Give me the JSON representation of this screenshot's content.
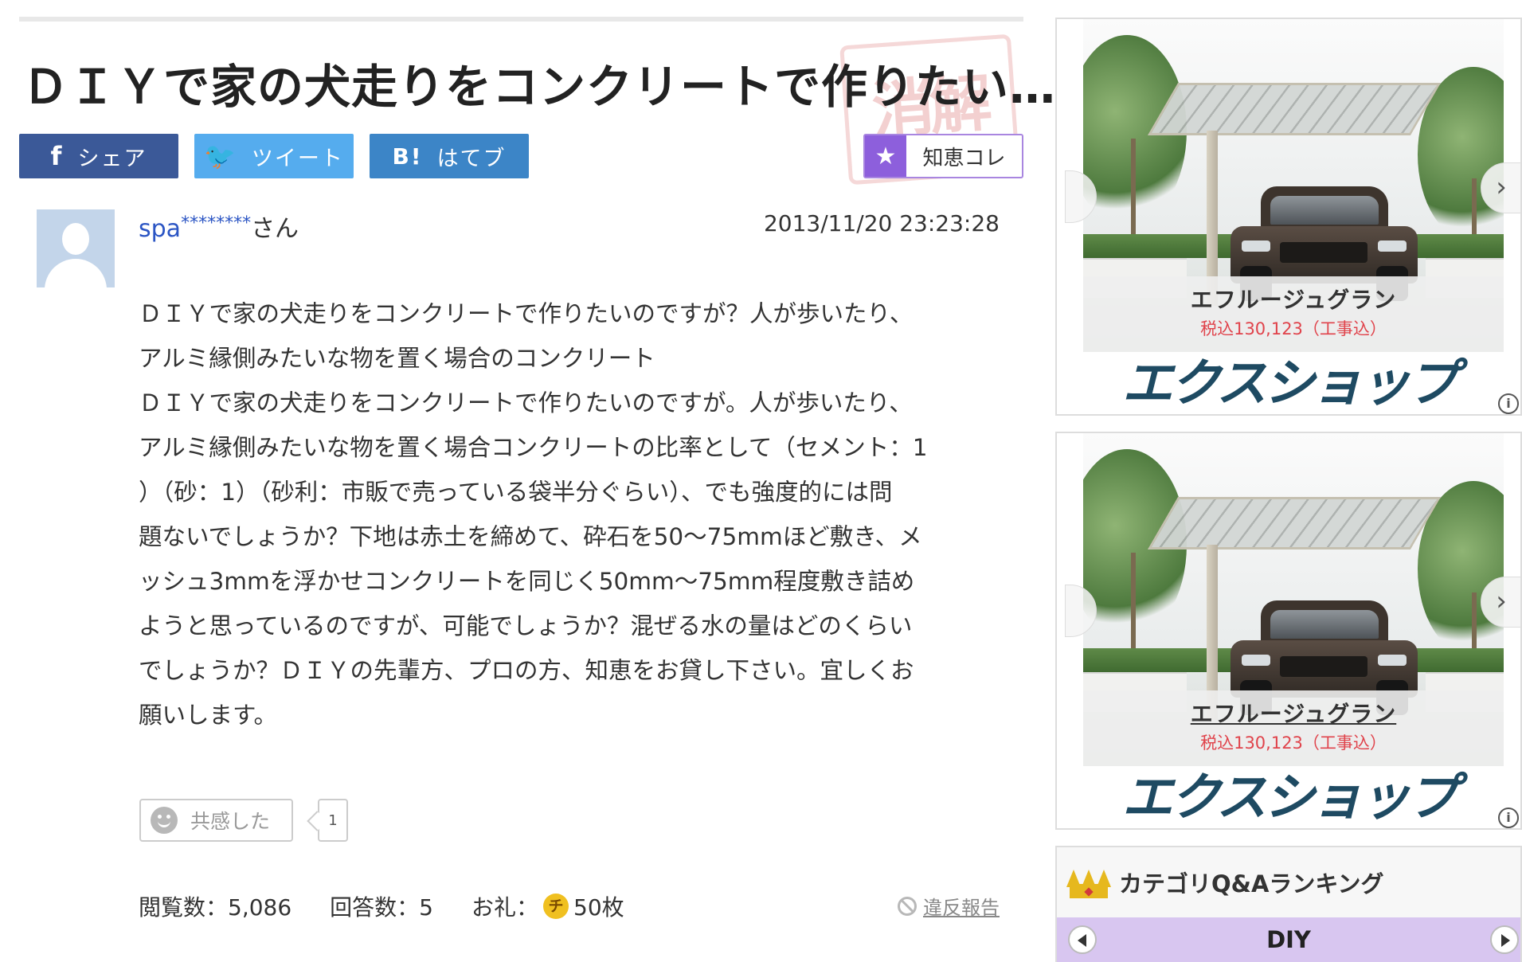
{
  "question": {
    "title": "ＤＩＹで家の犬走りをコンクリートで作りたい…",
    "stamp_text": "消解",
    "share": {
      "facebook_icon": "f",
      "facebook_label": "シェア",
      "twitter_icon": "🐦",
      "twitter_label": "ツイート",
      "hatena_icon": "B!",
      "hatena_label": "はてブ"
    },
    "chiekore_label": "知恵コレ",
    "user": {
      "name": "spa",
      "masked": "********",
      "suffix": "さん"
    },
    "datetime": "2013/11/20  23:23:28",
    "body_lines": [
      "ＤＩＹで家の犬走りをコンクリートで作りたいのですが？人が歩いたり、",
      "アルミ縁側みたいな物を置く場合のコンクリート",
      "ＤＩＹで家の犬走りをコンクリートで作りたいのですが。人が歩いたり、",
      "アルミ縁側みたいな物を置く場合コンクリートの比率として（セメント：1",
      "）（砂：1）（砂利：市販で売っている袋半分ぐらい）、でも強度的には問",
      "題ないでしょうか？下地は赤土を締めて、砕石を50～75mmほど敷き、メ",
      "ッシュ3mmを浮かせコンクリートを同じく50mm～75mm程度敷き詰め",
      "ようと思っているのですが、可能でしょうか？混ぜる水の量はどのくらい",
      "でしょうか？ＤＩＹの先輩方、プロの方、知恵をお貸し下さい。宜しくお",
      "願いします。"
    ],
    "empathy_label": "共感した",
    "empathy_count": "1",
    "views_label": "閲覧数：5,086",
    "answers_label": "回答数：5",
    "reward_prefix": "お礼：",
    "reward_coin": "チ",
    "reward_amount": "50枚",
    "report_label": "違反報告"
  },
  "ads": [
    {
      "product": "エフルージュグラン",
      "price": "税込130,123（工事込）",
      "brand": "エクスショップ",
      "info_icon": "i"
    },
    {
      "product": "エフルージュグラン",
      "price": "税込130,123（工事込）",
      "brand": "エクスショップ",
      "info_icon": "i"
    }
  ],
  "ranking": {
    "title": "カテゴリQ&Aランキング",
    "category": "DIY"
  },
  "icons": {
    "chevron_right": "›",
    "star": "★"
  }
}
